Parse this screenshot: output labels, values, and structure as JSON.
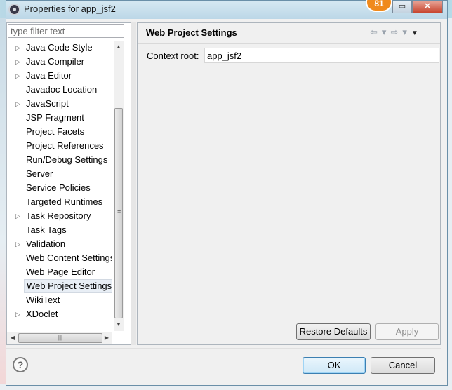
{
  "window": {
    "title": "Properties for app_jsf2",
    "badge_count": "81",
    "minimize_glyph": "▭",
    "close_glyph": "✕"
  },
  "filter": {
    "placeholder": "type filter text",
    "value": ""
  },
  "tree": {
    "items": [
      {
        "label": "Java Code Style",
        "expandable": true
      },
      {
        "label": "Java Compiler",
        "expandable": true
      },
      {
        "label": "Java Editor",
        "expandable": true
      },
      {
        "label": "Javadoc Location",
        "expandable": false
      },
      {
        "label": "JavaScript",
        "expandable": true
      },
      {
        "label": "JSP Fragment",
        "expandable": false
      },
      {
        "label": "Project Facets",
        "expandable": false
      },
      {
        "label": "Project References",
        "expandable": false
      },
      {
        "label": "Run/Debug Settings",
        "expandable": false
      },
      {
        "label": "Server",
        "expandable": false
      },
      {
        "label": "Service Policies",
        "expandable": false
      },
      {
        "label": "Targeted Runtimes",
        "expandable": false
      },
      {
        "label": "Task Repository",
        "expandable": true
      },
      {
        "label": "Task Tags",
        "expandable": false
      },
      {
        "label": "Validation",
        "expandable": true
      },
      {
        "label": "Web Content Settings",
        "expandable": false
      },
      {
        "label": "Web Page Editor",
        "expandable": false
      },
      {
        "label": "Web Project Settings",
        "expandable": false,
        "selected": true
      },
      {
        "label": "WikiText",
        "expandable": false
      },
      {
        "label": "XDoclet",
        "expandable": true
      }
    ]
  },
  "page": {
    "title": "Web Project Settings",
    "context_root_label": "Context root:",
    "context_root_value": "app_jsf2",
    "nav_back": "⇦",
    "nav_forward": "⇨",
    "nav_dropdown": "▾",
    "view_menu": "▼"
  },
  "buttons": {
    "restore_defaults": "Restore Defaults",
    "apply": "Apply",
    "ok": "OK",
    "cancel": "Cancel",
    "help": "?"
  },
  "icons": {
    "window_icon": "eclipse-gear-icon",
    "expand_icon": "triangle-right-icon",
    "help_icon": "question-mark-icon"
  }
}
